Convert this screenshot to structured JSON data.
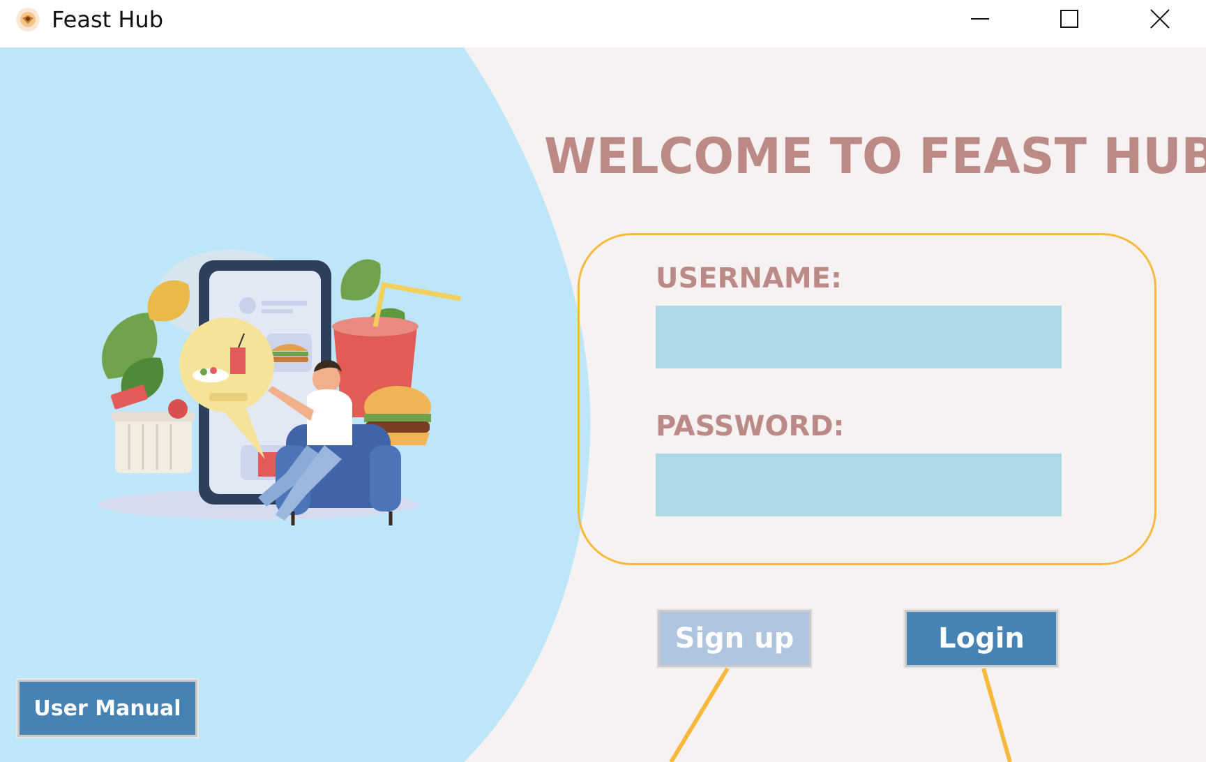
{
  "window": {
    "title": "Feast Hub",
    "icon": "feast-hub-logo",
    "controls": [
      "minimize-icon",
      "maximize-icon",
      "close-icon"
    ]
  },
  "main": {
    "welcome_text": "WELCOME TO FEAST HUB",
    "illustration": "food-order-illustration",
    "login_form": {
      "username_label": "USERNAME:",
      "username_value": "",
      "password_label": "PASSWORD:",
      "password_value": ""
    },
    "buttons": {
      "signup_label": "Sign up",
      "login_label": "Login",
      "manual_label": "User Manual"
    }
  },
  "colors": {
    "left_panel": "#bde7f8",
    "right_panel": "#f6f2f1",
    "heading": "#bc8a86",
    "frame_border": "#f7b93b",
    "input_bg": "#add8e6",
    "signup_bg": "#b0c4de",
    "login_bg": "#4682b4"
  }
}
